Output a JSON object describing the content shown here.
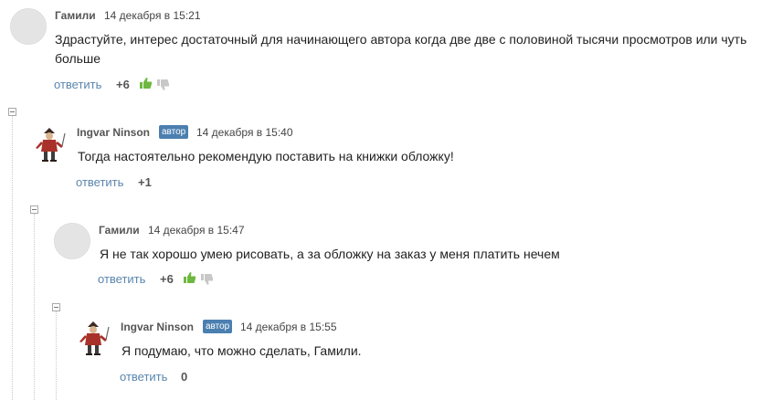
{
  "comments": [
    {
      "author": "Гамили",
      "badge": "",
      "date": "14 декабря в 15:21",
      "text": "Здрастуйте, интерес достаточный для начинающего автора когда две две с половиной тысячи просмотров или чуть больше",
      "reply": "ответить",
      "score": "+6",
      "avatar": "default-avatar",
      "has_votes": true
    },
    {
      "author": "Ingvar Ninson",
      "badge": "автор",
      "date": "14 декабря в 15:40",
      "text": "Тогда настоятельно рекомендую поставить на книжки обложку!",
      "reply": "ответить",
      "score": "+1",
      "avatar": "pirate-figure-avatar",
      "has_votes": false
    },
    {
      "author": "Гамили",
      "badge": "",
      "date": "14 декабря в 15:47",
      "text": "Я не так хорошо умею рисовать, а за обложку на заказ у меня платить нечем",
      "reply": "ответить",
      "score": "+6",
      "avatar": "default-avatar",
      "has_votes": true
    },
    {
      "author": "Ingvar Ninson",
      "badge": "автор",
      "date": "14 декабря в 15:55",
      "text": "Я подумаю, что можно сделать, Гамили.",
      "reply": "ответить",
      "score": "0",
      "avatar": "pirate-figure-avatar",
      "has_votes": false
    }
  ],
  "colors": {
    "link": "#5a86ad",
    "badge": "#4b7fb0",
    "thumb_up": "#6fb83f",
    "thumb_down": "#c8c8c8"
  }
}
